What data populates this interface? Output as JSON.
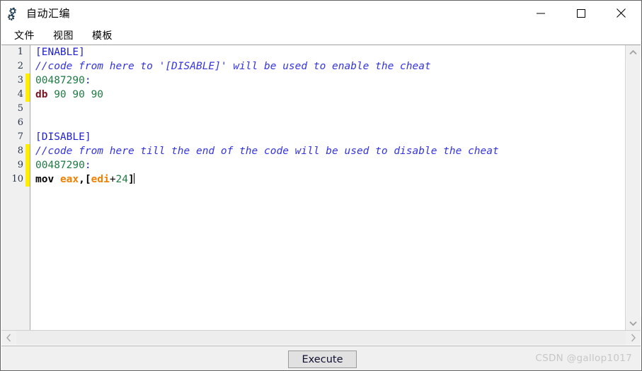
{
  "window": {
    "title": "自动汇编",
    "icon": "cheat-engine-logo",
    "controls": {
      "minimize": "—",
      "maximize": "□",
      "close": "✕"
    }
  },
  "menubar": {
    "items": [
      {
        "label": "文件",
        "name": "menu-file"
      },
      {
        "label": "视图",
        "name": "menu-view"
      },
      {
        "label": "模板",
        "name": "menu-template"
      }
    ]
  },
  "editor": {
    "total_lines": 10,
    "caret_line": 10,
    "modified_lines": [
      3,
      4,
      8,
      9,
      10
    ],
    "lines": [
      {
        "number": "1",
        "modified": false,
        "tokens": [
          {
            "text": "[ENABLE]",
            "type": "section"
          }
        ]
      },
      {
        "number": "2",
        "modified": false,
        "tokens": [
          {
            "text": "//code from here to '[DISABLE]' will be used to enable the cheat",
            "type": "comment"
          }
        ]
      },
      {
        "number": "3",
        "modified": true,
        "tokens": [
          {
            "text": "00487290",
            "type": "address"
          },
          {
            "text": ":",
            "type": "colon"
          }
        ]
      },
      {
        "number": "4",
        "modified": true,
        "tokens": [
          {
            "text": "db",
            "type": "db"
          },
          {
            "text": " ",
            "type": "plain"
          },
          {
            "text": "90 90 90",
            "type": "num"
          }
        ]
      },
      {
        "number": "5",
        "modified": false,
        "tokens": []
      },
      {
        "number": "6",
        "modified": false,
        "tokens": []
      },
      {
        "number": "7",
        "modified": false,
        "tokens": [
          {
            "text": "[DISABLE]",
            "type": "section"
          }
        ]
      },
      {
        "number": "8",
        "modified": true,
        "tokens": [
          {
            "text": "//code from here till the end of the code will be used to disable the cheat",
            "type": "comment"
          }
        ]
      },
      {
        "number": "9",
        "modified": true,
        "tokens": [
          {
            "text": "00487290",
            "type": "address"
          },
          {
            "text": ":",
            "type": "colon"
          }
        ]
      },
      {
        "number": "10",
        "modified": true,
        "tokens": [
          {
            "text": "mov",
            "type": "mnemonic"
          },
          {
            "text": " ",
            "type": "plain"
          },
          {
            "text": "eax",
            "type": "reg"
          },
          {
            "text": ",",
            "type": "punct"
          },
          {
            "text": "[",
            "type": "punct"
          },
          {
            "text": "edi",
            "type": "reg"
          },
          {
            "text": "+",
            "type": "plain"
          },
          {
            "text": "24",
            "type": "num"
          },
          {
            "text": "]",
            "type": "punct"
          }
        ],
        "caret": true
      }
    ]
  },
  "scrollbars": {
    "vertical": {
      "up": "∧",
      "down": "∨"
    },
    "horizontal": {
      "left": "‹",
      "right": "›"
    }
  },
  "bottom": {
    "execute_label": "Execute",
    "watermark": "CSDN @gallop1017"
  },
  "colors": {
    "section": "#2020d0",
    "comment": "#3434e0",
    "address": "#1f7a43",
    "db": "#7b1220",
    "number": "#1f7a43",
    "register": "#f08000",
    "modified_bar": "#ffee00",
    "gutter_bg": "#f0f0f0",
    "chrome_bg": "#f0f0f0",
    "watermark": "#c7c7c7"
  }
}
